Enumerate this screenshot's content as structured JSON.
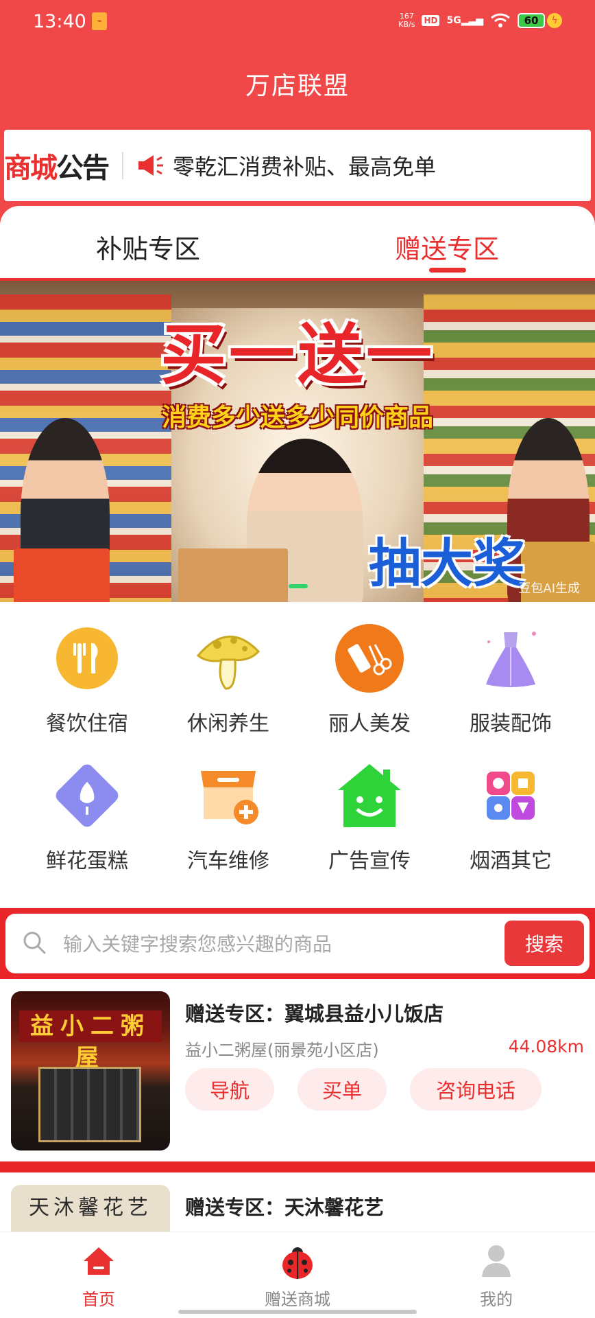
{
  "status": {
    "time": "13:40",
    "net_speed": "167",
    "net_speed_unit": "KB/s",
    "hd": "HD",
    "signal": "5G",
    "battery": "60"
  },
  "header": {
    "title": "万店联盟"
  },
  "notice": {
    "logo_a": "商城",
    "logo_b": "公告",
    "text": "零乾汇消费补贴、最高免单"
  },
  "tabs": [
    {
      "label": "补贴专区",
      "active": false
    },
    {
      "label": "赠送专区",
      "active": true
    }
  ],
  "banner": {
    "headline": "买一送一",
    "subline": "消费多少送多少同价商品",
    "draw": "抽大奖",
    "ai_mark": "豆包AI生成"
  },
  "categories": [
    {
      "label": "餐饮住宿",
      "icon": "utensils-icon",
      "color": "#f7b731"
    },
    {
      "label": "休闲养生",
      "icon": "mushroom-icon",
      "color": "#f2d64b"
    },
    {
      "label": "丽人美发",
      "icon": "comb-scissors-icon",
      "color": "#f07a1a"
    },
    {
      "label": "服装配饰",
      "icon": "dress-icon",
      "color": "#a78bf0"
    },
    {
      "label": "鲜花蛋糕",
      "icon": "flower-icon",
      "color": "#8b8bf0"
    },
    {
      "label": "汽车维修",
      "icon": "shop-add-icon",
      "color": "#f58a2a"
    },
    {
      "label": "广告宣传",
      "icon": "smile-house-icon",
      "color": "#2ed33a"
    },
    {
      "label": "烟酒其它",
      "icon": "apps-grid-icon",
      "color": "#f04a8a"
    }
  ],
  "search": {
    "placeholder": "输入关键字搜索您感兴趣的商品",
    "button": "搜索"
  },
  "stores": [
    {
      "title": "赠送专区：翼城县益小儿饭店",
      "subtitle": "益小二粥屋(丽景苑小区店)",
      "distance": "44.08km",
      "sign": "益小二粥屋",
      "buttons": {
        "nav": "导航",
        "pay": "买单",
        "call": "咨询电话"
      }
    },
    {
      "title": "赠送专区：天沐馨花艺",
      "sign": "天沐馨花艺"
    }
  ],
  "bottom_nav": [
    {
      "label": "首页",
      "icon": "home-icon",
      "active": true
    },
    {
      "label": "赠送商城",
      "icon": "ladybug-icon",
      "active": false
    },
    {
      "label": "我的",
      "icon": "user-icon",
      "active": false
    }
  ],
  "colors": {
    "brand": "#f04848",
    "accent": "#e83030"
  }
}
